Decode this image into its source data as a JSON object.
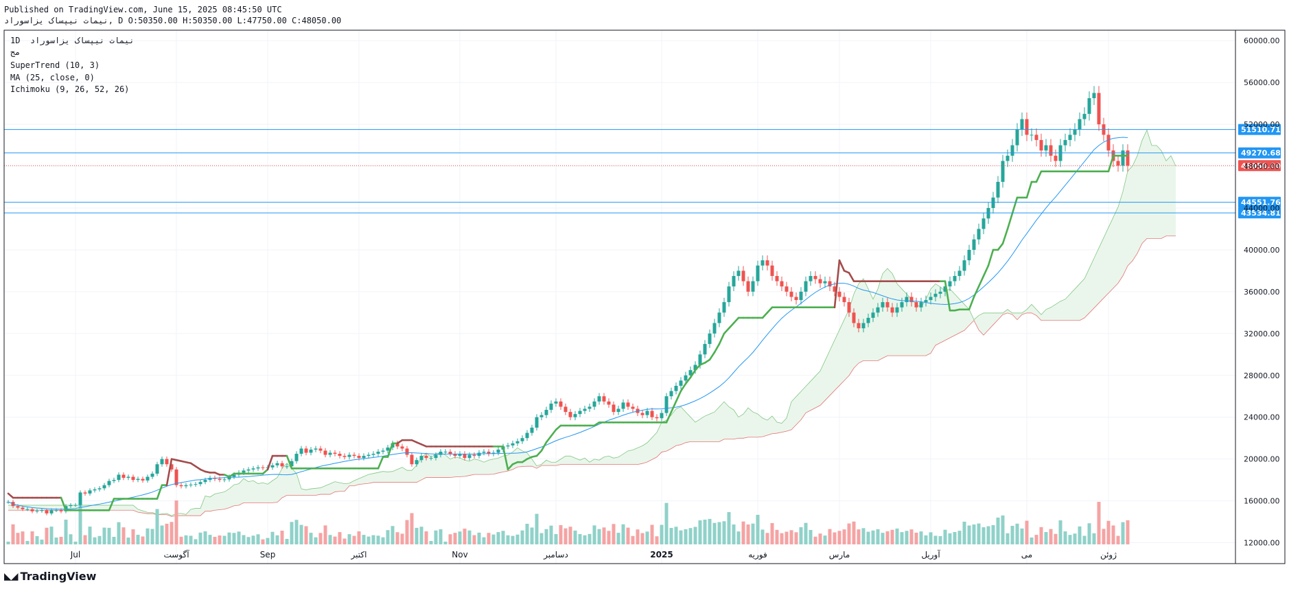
{
  "header": {
    "published": "Published on TradingView.com, June 15, 2025 08:45:50 UTC",
    "ohlc": "نیمات نیپساک یزاسوراد, D O:50350.00 H:50350.00 L:47750.00 C:48050.00"
  },
  "legend": {
    "interval": "1D",
    "symbol": "نیمات نیپساک یزاسوراد",
    "exchange": "مج",
    "supertrend": "SuperTrend (10, 3)",
    "ma": "MA (25, close, 0)",
    "ichimoku": "Ichimoku (9, 26, 52, 26)"
  },
  "footer": {
    "brand": "TradingView"
  },
  "colors": {
    "up": "#26a69a",
    "down": "#ef5350",
    "supertrend_up": "#4caf50",
    "supertrend_down": "#a44b4b",
    "ma": "#2196f3",
    "hline": "#2196f3",
    "last_price": "#ef5350",
    "vol_up": "#8fd1c8",
    "vol_down": "#f5a3a3"
  },
  "chart_data": {
    "type": "candlestick",
    "ylim": [
      10000,
      61000
    ],
    "y_ticks": [
      12000,
      16000,
      20000,
      24000,
      28000,
      32000,
      36000,
      40000,
      44000,
      48000,
      52000,
      56000,
      60000
    ],
    "y_tick_labels": [
      "12000.00",
      "16000.00",
      "20000.00",
      "24000.00",
      "28000.00",
      "32000.00",
      "36000.00",
      "40000.00",
      "44000.00",
      "48000.00",
      "52000.00",
      "56000.00",
      "60000.00"
    ],
    "x_ticks": [
      {
        "label": "Jul",
        "bar": 14
      },
      {
        "label": "آگوست",
        "bar": 35
      },
      {
        "label": "Sep",
        "bar": 54
      },
      {
        "label": "اکتبر",
        "bar": 73
      },
      {
        "label": "Nov",
        "bar": 94
      },
      {
        "label": "دسامبر",
        "bar": 114
      },
      {
        "label": "2025",
        "bar": 136
      },
      {
        "label": "فوریه",
        "bar": 156
      },
      {
        "label": "مارس",
        "bar": 173
      },
      {
        "label": "آوریل",
        "bar": 192
      },
      {
        "label": "می",
        "bar": 212
      },
      {
        "label": "ژوئن",
        "bar": 229
      }
    ],
    "price_lines": [
      {
        "value": 51510.71,
        "label": "51510.71"
      },
      {
        "value": 49270.68,
        "label": "49270.68"
      },
      {
        "value": 44551.76,
        "label": "44551.76"
      },
      {
        "value": 43534.81,
        "label": "43534.81"
      }
    ],
    "last_price": {
      "value": 48050.0,
      "label": "48050.00"
    },
    "closes": [
      15900,
      15500,
      15350,
      15200,
      15200,
      15000,
      15050,
      15100,
      14800,
      15100,
      15100,
      15000,
      15500,
      15600,
      15600,
      16800,
      16700,
      17000,
      17100,
      17200,
      17500,
      17900,
      18000,
      18500,
      18200,
      18300,
      18000,
      18100,
      17950,
      18300,
      18600,
      19500,
      20000,
      19500,
      19000,
      17500,
      17400,
      17500,
      17550,
      17600,
      17800,
      18000,
      18200,
      18100,
      18000,
      18050,
      18300,
      18500,
      18700,
      18900,
      19000,
      19100,
      19200,
      19150,
      19200,
      19400,
      19600,
      19300,
      19300,
      19800,
      20500,
      21000,
      20600,
      20900,
      21000,
      20800,
      20400,
      20600,
      20500,
      20300,
      20200,
      20400,
      20300,
      20100,
      20300,
      20400,
      20500,
      20700,
      20800,
      21100,
      21500,
      21200,
      21000,
      20400,
      19500,
      19900,
      20300,
      20100,
      20100,
      20400,
      20700,
      20700,
      20500,
      20300,
      20500,
      20100,
      20400,
      20300,
      20600,
      20700,
      20500,
      20600,
      20900,
      21200,
      21300,
      21500,
      21700,
      22000,
      22500,
      23000,
      24000,
      24200,
      24700,
      25300,
      25500,
      25000,
      24500,
      24000,
      24300,
      24600,
      24800,
      25000,
      25500,
      26000,
      25500,
      25200,
      24500,
      24800,
      25400,
      25000,
      24800,
      24400,
      24200,
      24600,
      24000,
      23900,
      24400,
      26000,
      26500,
      27000,
      27500,
      28000,
      28500,
      29000,
      30000,
      31000,
      32000,
      33000,
      34000,
      35000,
      36500,
      37500,
      38000,
      37000,
      36000,
      37000,
      38500,
      39000,
      38500,
      37500,
      37000,
      36500,
      36000,
      35500,
      35200,
      36000,
      37000,
      37500,
      37200,
      36800,
      37000,
      36500,
      36000,
      35500,
      35000,
      34000,
      33000,
      32500,
      33000,
      33500,
      34000,
      34500,
      35000,
      34500,
      34000,
      34500,
      35000,
      35500,
      35000,
      34500,
      35000,
      35200,
      35500,
      35800,
      36000,
      36500,
      37000,
      37500,
      38000,
      39000,
      40000,
      41000,
      42000,
      43000,
      44000,
      45000,
      46500,
      48500,
      49000,
      50000,
      51500,
      52500,
      51000,
      51000,
      50500,
      49500,
      50000,
      49000,
      48500,
      50000,
      50500,
      51000,
      51500,
      52500,
      53000,
      54500,
      55000,
      52000,
      51000,
      49500,
      48500,
      48050,
      49500,
      48050
    ],
    "supertrend": [
      16700,
      16300,
      16300,
      16300,
      16300,
      16300,
      16300,
      16300,
      16300,
      16300,
      16300,
      16300,
      15100,
      15100,
      15100,
      15100,
      15100,
      15100,
      15100,
      15100,
      15100,
      15100,
      16200,
      16200,
      16200,
      16200,
      16200,
      16200,
      16200,
      16200,
      16200,
      16200,
      17500,
      17500,
      20000,
      19900,
      19800,
      19700,
      19600,
      19300,
      19000,
      18800,
      18700,
      18700,
      18500,
      18500,
      18300,
      18600,
      18600,
      18600,
      18600,
      18600,
      18600,
      18600,
      19000,
      20300,
      20300,
      20300,
      20300,
      19100,
      19100,
      19100,
      19100,
      19100,
      19100,
      19100,
      19100,
      19100,
      19100,
      19100,
      19100,
      19100,
      19100,
      19100,
      19100,
      19100,
      19100,
      19100,
      20200,
      20200,
      21500,
      21500,
      21800,
      21800,
      21800,
      21600,
      21400,
      21200,
      21200,
      21200,
      21200,
      21200,
      21200,
      21200,
      21200,
      21200,
      21200,
      21200,
      21200,
      21200,
      21200,
      21200,
      21200,
      21200,
      19000,
      19500,
      19700,
      19700,
      20000,
      20200,
      20300,
      20800,
      21600,
      22200,
      22800,
      23200,
      23200,
      23200,
      23200,
      23200,
      23200,
      23200,
      23200,
      23500,
      23500,
      23500,
      23500,
      23500,
      23500,
      23500,
      23500,
      23500,
      23500,
      23500,
      23500,
      23500,
      23500,
      23500,
      24500,
      25500,
      26500,
      27200,
      27800,
      28500,
      29000,
      29200,
      29500,
      30200,
      31000,
      32000,
      32500,
      33000,
      33500,
      33500,
      33500,
      33500,
      33500,
      33500,
      34000,
      34500,
      34500,
      34500,
      34500,
      34500,
      34500,
      34500,
      34500,
      34500,
      34500,
      34500,
      34500,
      34500,
      34500,
      39000,
      38000,
      37800,
      37000,
      37000,
      37000,
      37000,
      37000,
      37000,
      37000,
      37000,
      37000,
      37000,
      37000,
      37000,
      37000,
      37000,
      37000,
      37000,
      37000,
      37000,
      37000,
      37000,
      34200,
      34200,
      34300,
      34300,
      34300,
      35500,
      36500,
      37500,
      38500,
      40000,
      40000,
      40600,
      42000,
      43500,
      45000,
      45000,
      45000,
      46500,
      46500,
      47500,
      47500,
      47500,
      47500,
      47500,
      47500,
      47500,
      47500,
      47500,
      47500,
      47500,
      47500,
      47500,
      47500,
      47500,
      49000,
      49000,
      49000,
      49000,
      49000,
      49000,
      52000,
      55000,
      54500,
      54500
    ]
  }
}
